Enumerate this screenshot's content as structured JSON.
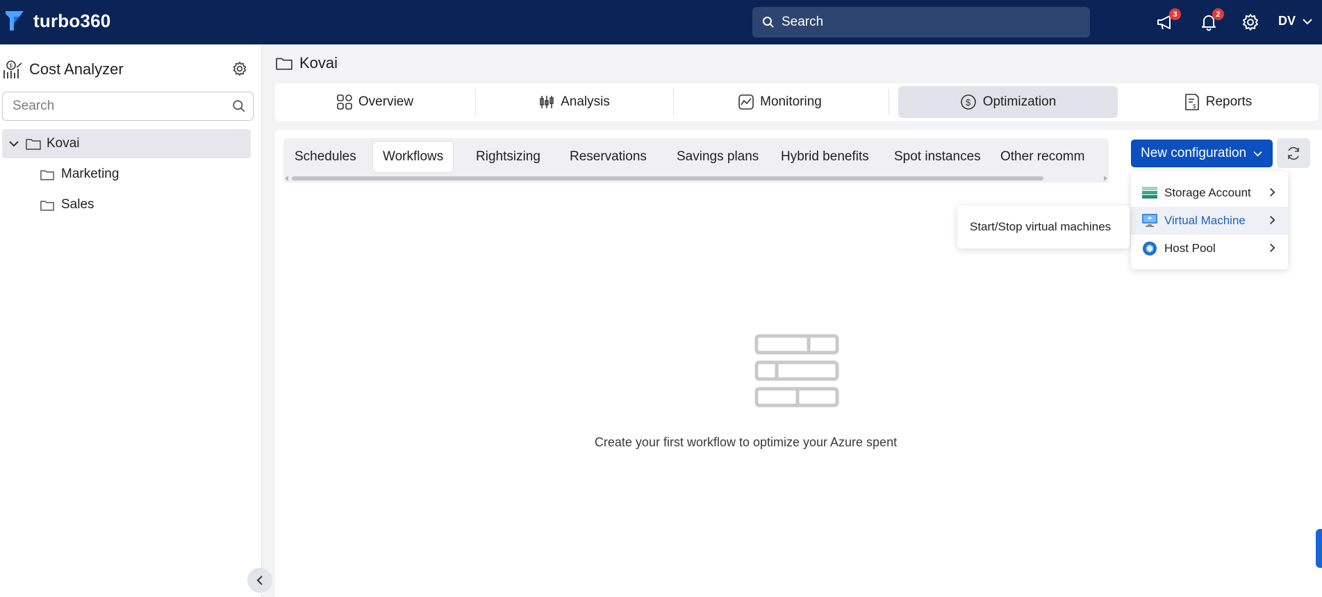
{
  "app": {
    "brand": "turbo360"
  },
  "topbar": {
    "search_placeholder": "Search",
    "announcements_badge": "3",
    "notifications_badge": "2",
    "user_initials": "DV"
  },
  "sidebar": {
    "title": "Cost Analyzer",
    "search_placeholder": "Search",
    "tree": {
      "root": "Kovai",
      "children": [
        "Marketing",
        "Sales"
      ]
    }
  },
  "breadcrumb": {
    "label": "Kovai"
  },
  "main_tabs": [
    {
      "label": "Overview"
    },
    {
      "label": "Analysis"
    },
    {
      "label": "Monitoring"
    },
    {
      "label": "Optimization"
    },
    {
      "label": "Reports"
    }
  ],
  "sub_tabs": [
    {
      "label": "Schedules"
    },
    {
      "label": "Workflows"
    },
    {
      "label": "Rightsizing"
    },
    {
      "label": "Reservations"
    },
    {
      "label": "Savings plans"
    },
    {
      "label": "Hybrid benefits"
    },
    {
      "label": "Spot instances"
    },
    {
      "label": "Other recomm"
    }
  ],
  "new_config": {
    "label": "New configuration",
    "menu": [
      {
        "label": "Storage Account"
      },
      {
        "label": "Virtual Machine"
      },
      {
        "label": "Host Pool"
      }
    ],
    "submenu": [
      "Start/Stop virtual machines"
    ]
  },
  "empty_state": {
    "message": "Create your first workflow to optimize your Azure spent"
  },
  "colors": {
    "topbar": "#0a2458",
    "primary": "#0b4fc1",
    "accent_link": "#1f5fbf",
    "badge": "#e23b3b"
  }
}
